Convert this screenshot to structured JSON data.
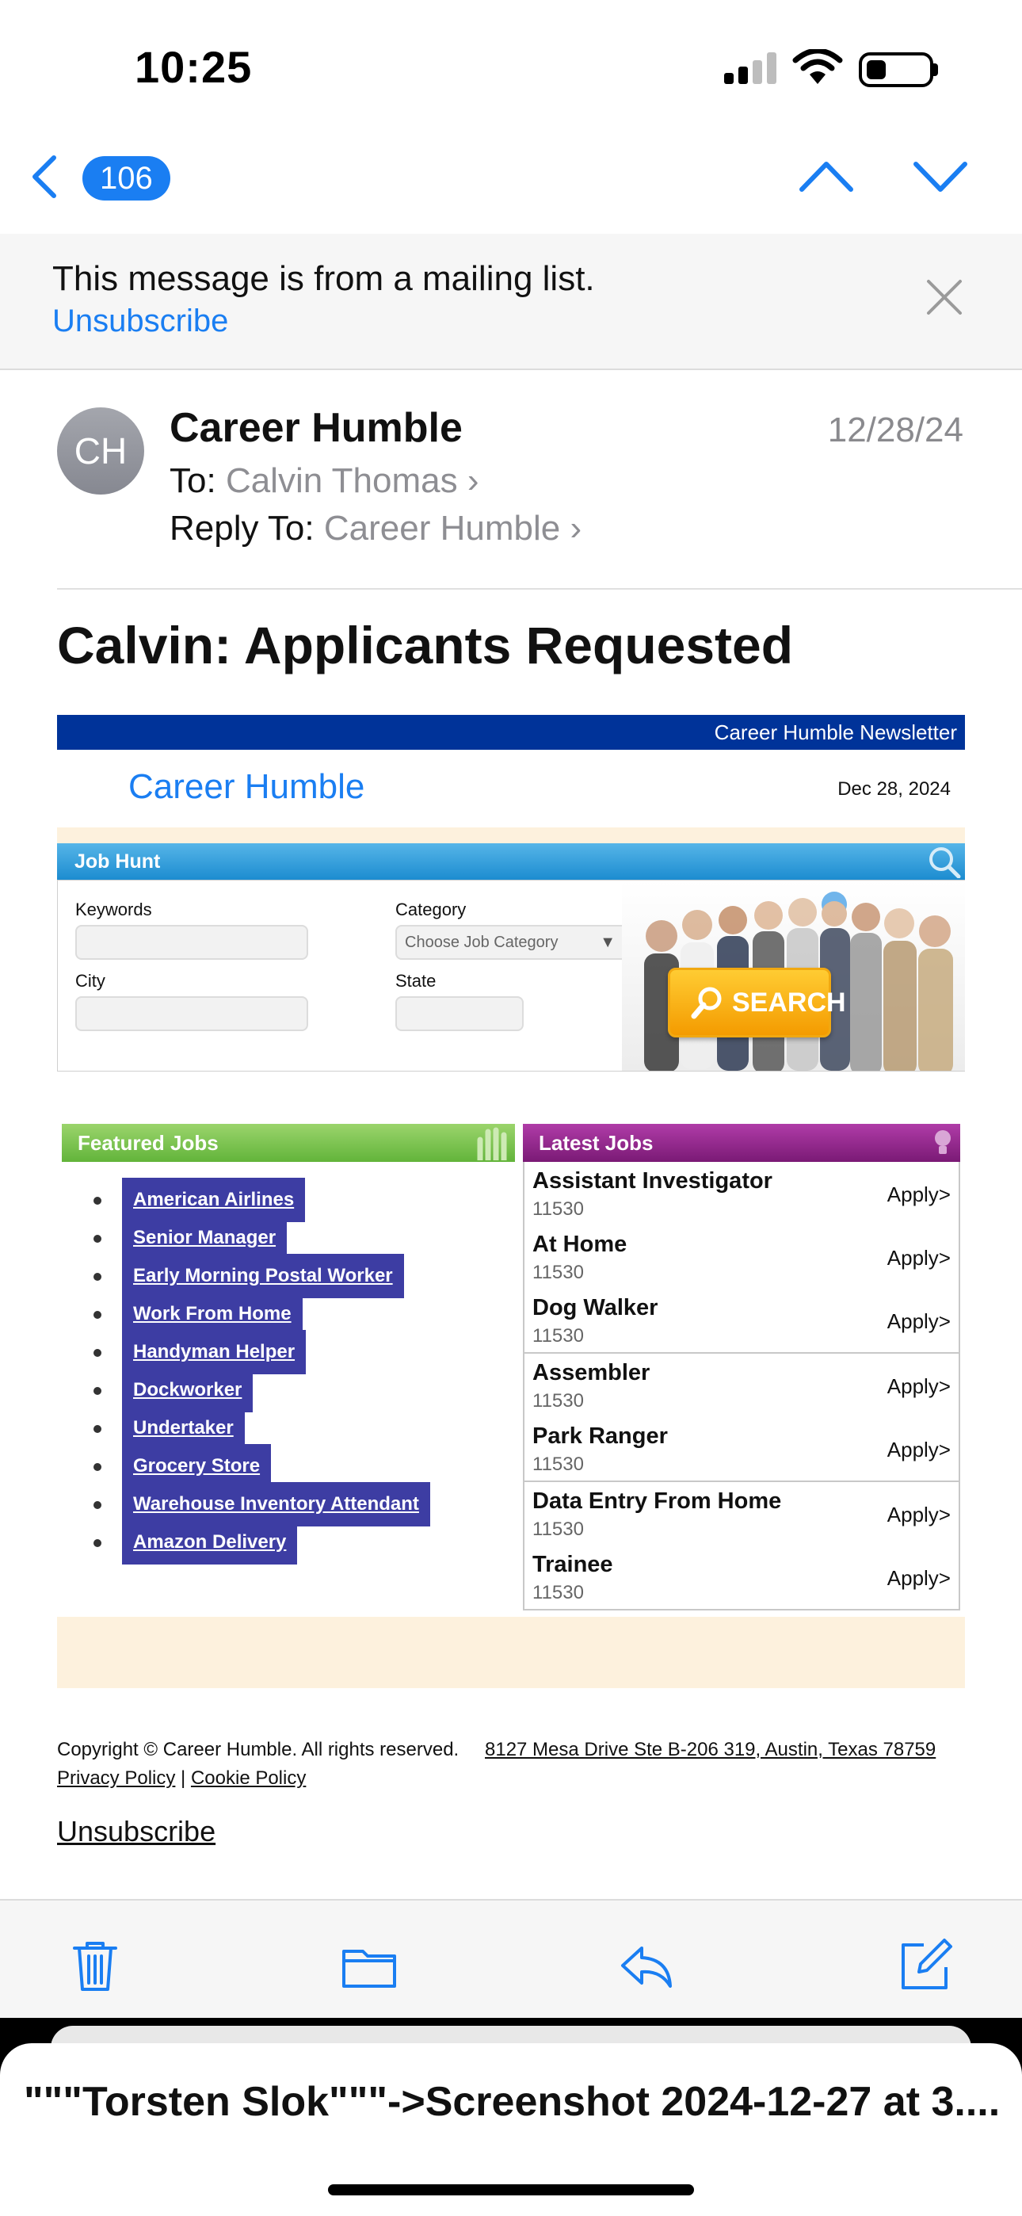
{
  "status_bar": {
    "time": "10:25"
  },
  "nav": {
    "message_count": "106"
  },
  "mailing_banner": {
    "text": "This message is from a mailing list.",
    "unsubscribe_label": "Unsubscribe"
  },
  "header": {
    "avatar_initials": "CH",
    "sender": "Career Humble",
    "date": "12/28/24",
    "to_label": "To:",
    "to_name": "Calvin Thomas",
    "reply_to_label": "Reply To:",
    "reply_to_name": "Career Humble",
    "subject": "Calvin: Applicants Requested"
  },
  "email": {
    "newsletter_label": "Career Humble Newsletter",
    "brand": "Career Humble",
    "issue_date": "Dec 28, 2024",
    "job_hunt": {
      "title": "Job Hunt",
      "keywords_label": "Keywords",
      "category_label": "Category",
      "category_placeholder": "Choose Job Category",
      "city_label": "City",
      "state_label": "State",
      "search_label": "SEARCH"
    },
    "featured": {
      "title": "Featured Jobs",
      "items": [
        "American Airlines",
        "Senior Manager",
        "Early Morning Postal Worker",
        "Work From Home",
        "Handyman Helper",
        "Dockworker",
        "Undertaker",
        "Grocery Store",
        "Warehouse Inventory Attendant",
        "Amazon Delivery"
      ]
    },
    "latest": {
      "title": "Latest Jobs",
      "apply_label": "Apply>",
      "groups": [
        [
          {
            "title": "Assistant Investigator",
            "zip": "11530"
          },
          {
            "title": "At Home",
            "zip": "11530"
          },
          {
            "title": "Dog Walker",
            "zip": "11530"
          }
        ],
        [
          {
            "title": "Assembler",
            "zip": "11530"
          },
          {
            "title": "Park Ranger",
            "zip": "11530"
          }
        ],
        [
          {
            "title": "Data Entry From Home",
            "zip": "11530"
          },
          {
            "title": "Trainee",
            "zip": "11530"
          }
        ]
      ]
    },
    "footer": {
      "copyright": "Copyright © Career Humble. All rights reserved.",
      "address": "8127 Mesa Drive Ste B-206 319, Austin, Texas 78759",
      "privacy": "Privacy Policy",
      "separator": "|",
      "cookie": "Cookie Policy",
      "unsubscribe": "Unsubscribe"
    }
  },
  "toolbar": {
    "icons": [
      "trash-icon",
      "folder-icon",
      "reply-icon",
      "compose-icon"
    ],
    "accent": "#1a7ef2"
  },
  "bottom_sheet": {
    "title": "\"\"\"Torsten Slok\"\"\"->Screenshot 2024-12-27 at 3...."
  }
}
